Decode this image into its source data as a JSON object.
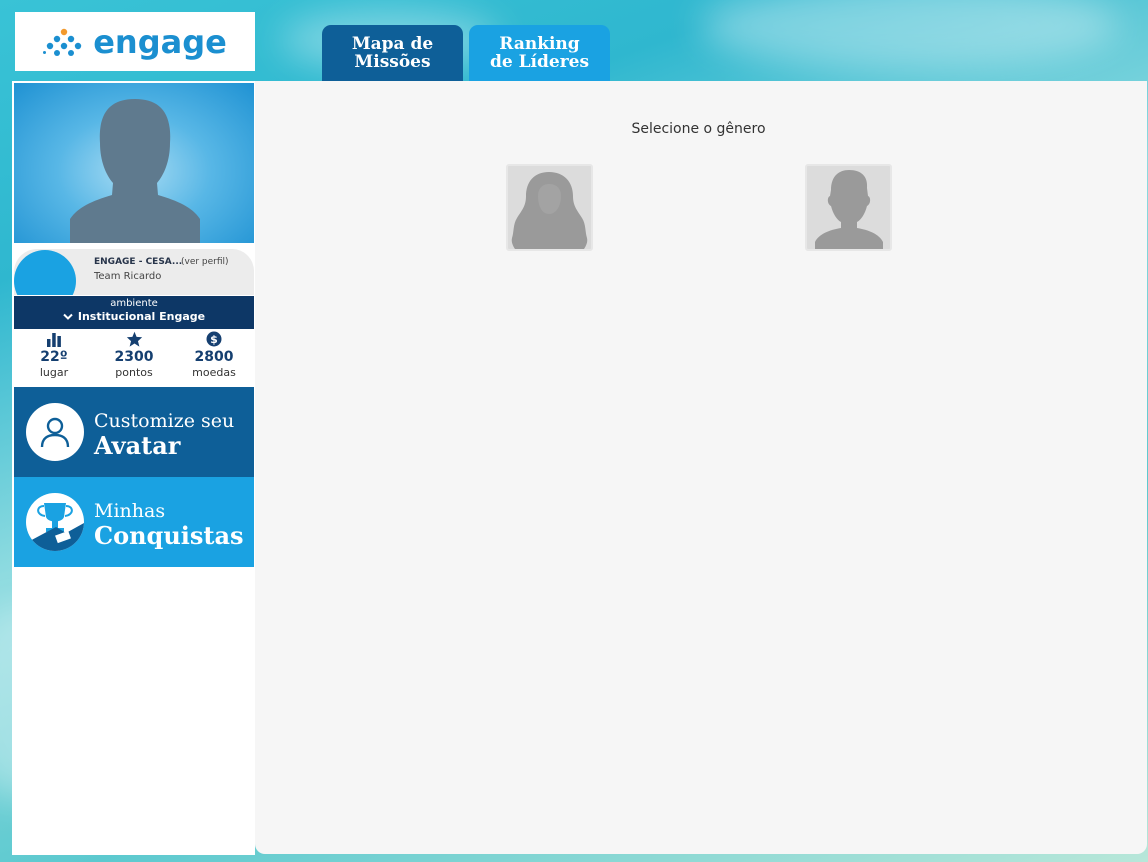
{
  "brand": {
    "logo_text": "engage",
    "logo_color": "#1b8fd0",
    "logo_icon": "dot-pyramid-icon"
  },
  "tabs": [
    {
      "line1": "Mapa de",
      "line2": "Missões",
      "color": "#0e5f98",
      "active": true
    },
    {
      "line1": "Ranking",
      "line2": "de Líderes",
      "color": "#1aa2e2",
      "active": false
    }
  ],
  "profile": {
    "photo_icon": "person-silhouette-icon",
    "name": "ENGAGE - CESA...",
    "profile_link": "(ver perfil)",
    "team": "Team Ricardo"
  },
  "environment": {
    "label": "ambiente",
    "value": "Institucional Engage",
    "dropdown_icon": "chevron-down-icon"
  },
  "stats": [
    {
      "icon": "bar-chart-icon",
      "value": "22º",
      "label": "lugar"
    },
    {
      "icon": "star-icon",
      "value": "2300",
      "label": "pontos"
    },
    {
      "icon": "coin-icon",
      "value": "2800",
      "label": "moedas"
    }
  ],
  "banners": [
    {
      "line1": "Customize seu",
      "line2": "Avatar",
      "icon": "user-outline-icon",
      "color": "#0e5f98"
    },
    {
      "line1": "Minhas",
      "line2": "Conquistas",
      "icon": "trophy-icon",
      "color": "#1aa2e2"
    }
  ],
  "gender_selection": {
    "title": "Selecione o gênero",
    "options": [
      {
        "icon": "female-silhouette-icon"
      },
      {
        "icon": "male-silhouette-icon"
      }
    ]
  }
}
